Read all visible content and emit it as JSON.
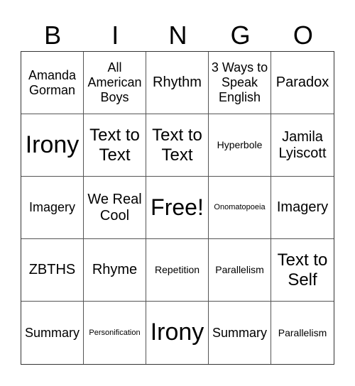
{
  "header": {
    "letters": [
      "B",
      "I",
      "N",
      "G",
      "O"
    ]
  },
  "cells": [
    {
      "text": "Amanda Gorman",
      "size": "md"
    },
    {
      "text": "All American Boys",
      "size": "md"
    },
    {
      "text": "Rhythm",
      "size": "lg"
    },
    {
      "text": "3 Ways to Speak English",
      "size": "md"
    },
    {
      "text": "Paradox",
      "size": "lg"
    },
    {
      "text": "Irony",
      "size": "xxl"
    },
    {
      "text": "Text to Text",
      "size": "xl"
    },
    {
      "text": "Text to Text",
      "size": "xl"
    },
    {
      "text": "Hyperbole",
      "size": "sm"
    },
    {
      "text": "Jamila Lyiscott",
      "size": "lg"
    },
    {
      "text": "Imagery",
      "size": "md"
    },
    {
      "text": "We Real Cool",
      "size": "lg"
    },
    {
      "text": "Free!",
      "size": "free"
    },
    {
      "text": "Onomatopoeia",
      "size": "xs"
    },
    {
      "text": "Imagery",
      "size": "lg"
    },
    {
      "text": "ZBTHS",
      "size": "lg"
    },
    {
      "text": "Rhyme",
      "size": "lg"
    },
    {
      "text": "Repetition",
      "size": "sm"
    },
    {
      "text": "Parallelism",
      "size": "sm"
    },
    {
      "text": "Text to Self",
      "size": "xl"
    },
    {
      "text": "Summary",
      "size": "md"
    },
    {
      "text": "Personification",
      "size": "xs"
    },
    {
      "text": "Irony",
      "size": "xxl"
    },
    {
      "text": "Summary",
      "size": "md"
    },
    {
      "text": "Parallelism",
      "size": "sm"
    }
  ]
}
